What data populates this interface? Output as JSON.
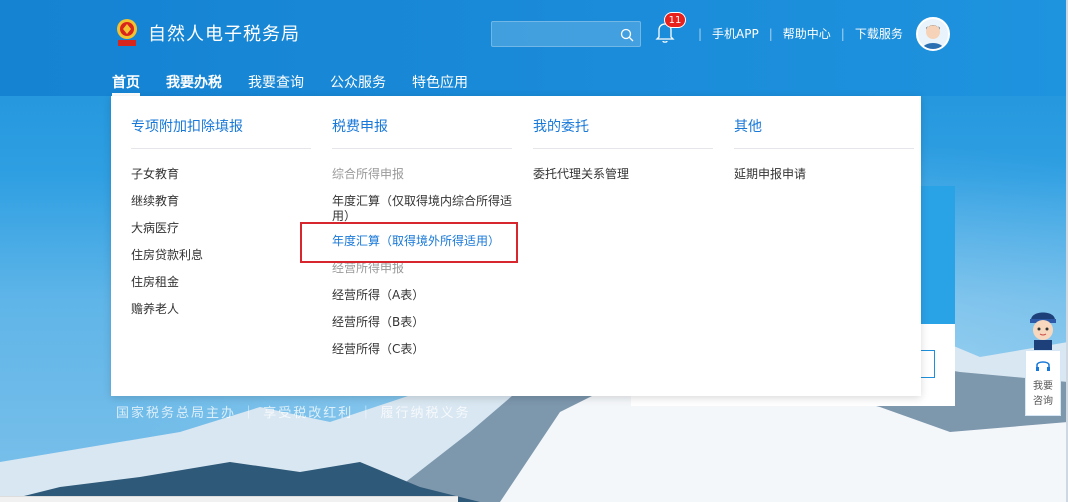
{
  "header": {
    "site_title": "自然人电子税务局",
    "notification_count": "11",
    "links": [
      "手机APP",
      "帮助中心",
      "下载服务"
    ]
  },
  "nav": [
    "首页",
    "我要办税",
    "我要查询",
    "公众服务",
    "特色应用"
  ],
  "dropdown": {
    "columns": [
      {
        "title": "专项附加扣除填报",
        "items": [
          "子女教育",
          "继续教育",
          "大病医疗",
          "住房贷款利息",
          "住房租金",
          "赡养老人"
        ]
      },
      {
        "title": "税费申报",
        "items": [
          {
            "text": "综合所得申报",
            "type": "subheading"
          },
          {
            "text": "年度汇算（仅取得境内综合所得适用）",
            "type": "item"
          },
          {
            "text": "年度汇算（取得境外所得适用）",
            "type": "highlighted"
          },
          {
            "text": "经营所得申报",
            "type": "subheading"
          },
          {
            "text": "经营所得（A表）",
            "type": "item"
          },
          {
            "text": "经营所得（B表）",
            "type": "item"
          },
          {
            "text": "经营所得（C表）",
            "type": "item"
          }
        ]
      },
      {
        "title": "我的委托",
        "items": [
          "委托代理关系管理"
        ]
      },
      {
        "title": "其他",
        "items": [
          "延期申报申请"
        ]
      }
    ]
  },
  "slogan": "国家税务总局主办 ｜ 享受税改红利 ｜ 履行纳税义务",
  "float_service": {
    "label_line1": "我要",
    "label_line2": "咨询"
  },
  "colors": {
    "brand_blue": "#1878d8",
    "header_blue": "#1582d2",
    "highlight_red": "#d8262e",
    "badge_red": "#e8211c"
  }
}
